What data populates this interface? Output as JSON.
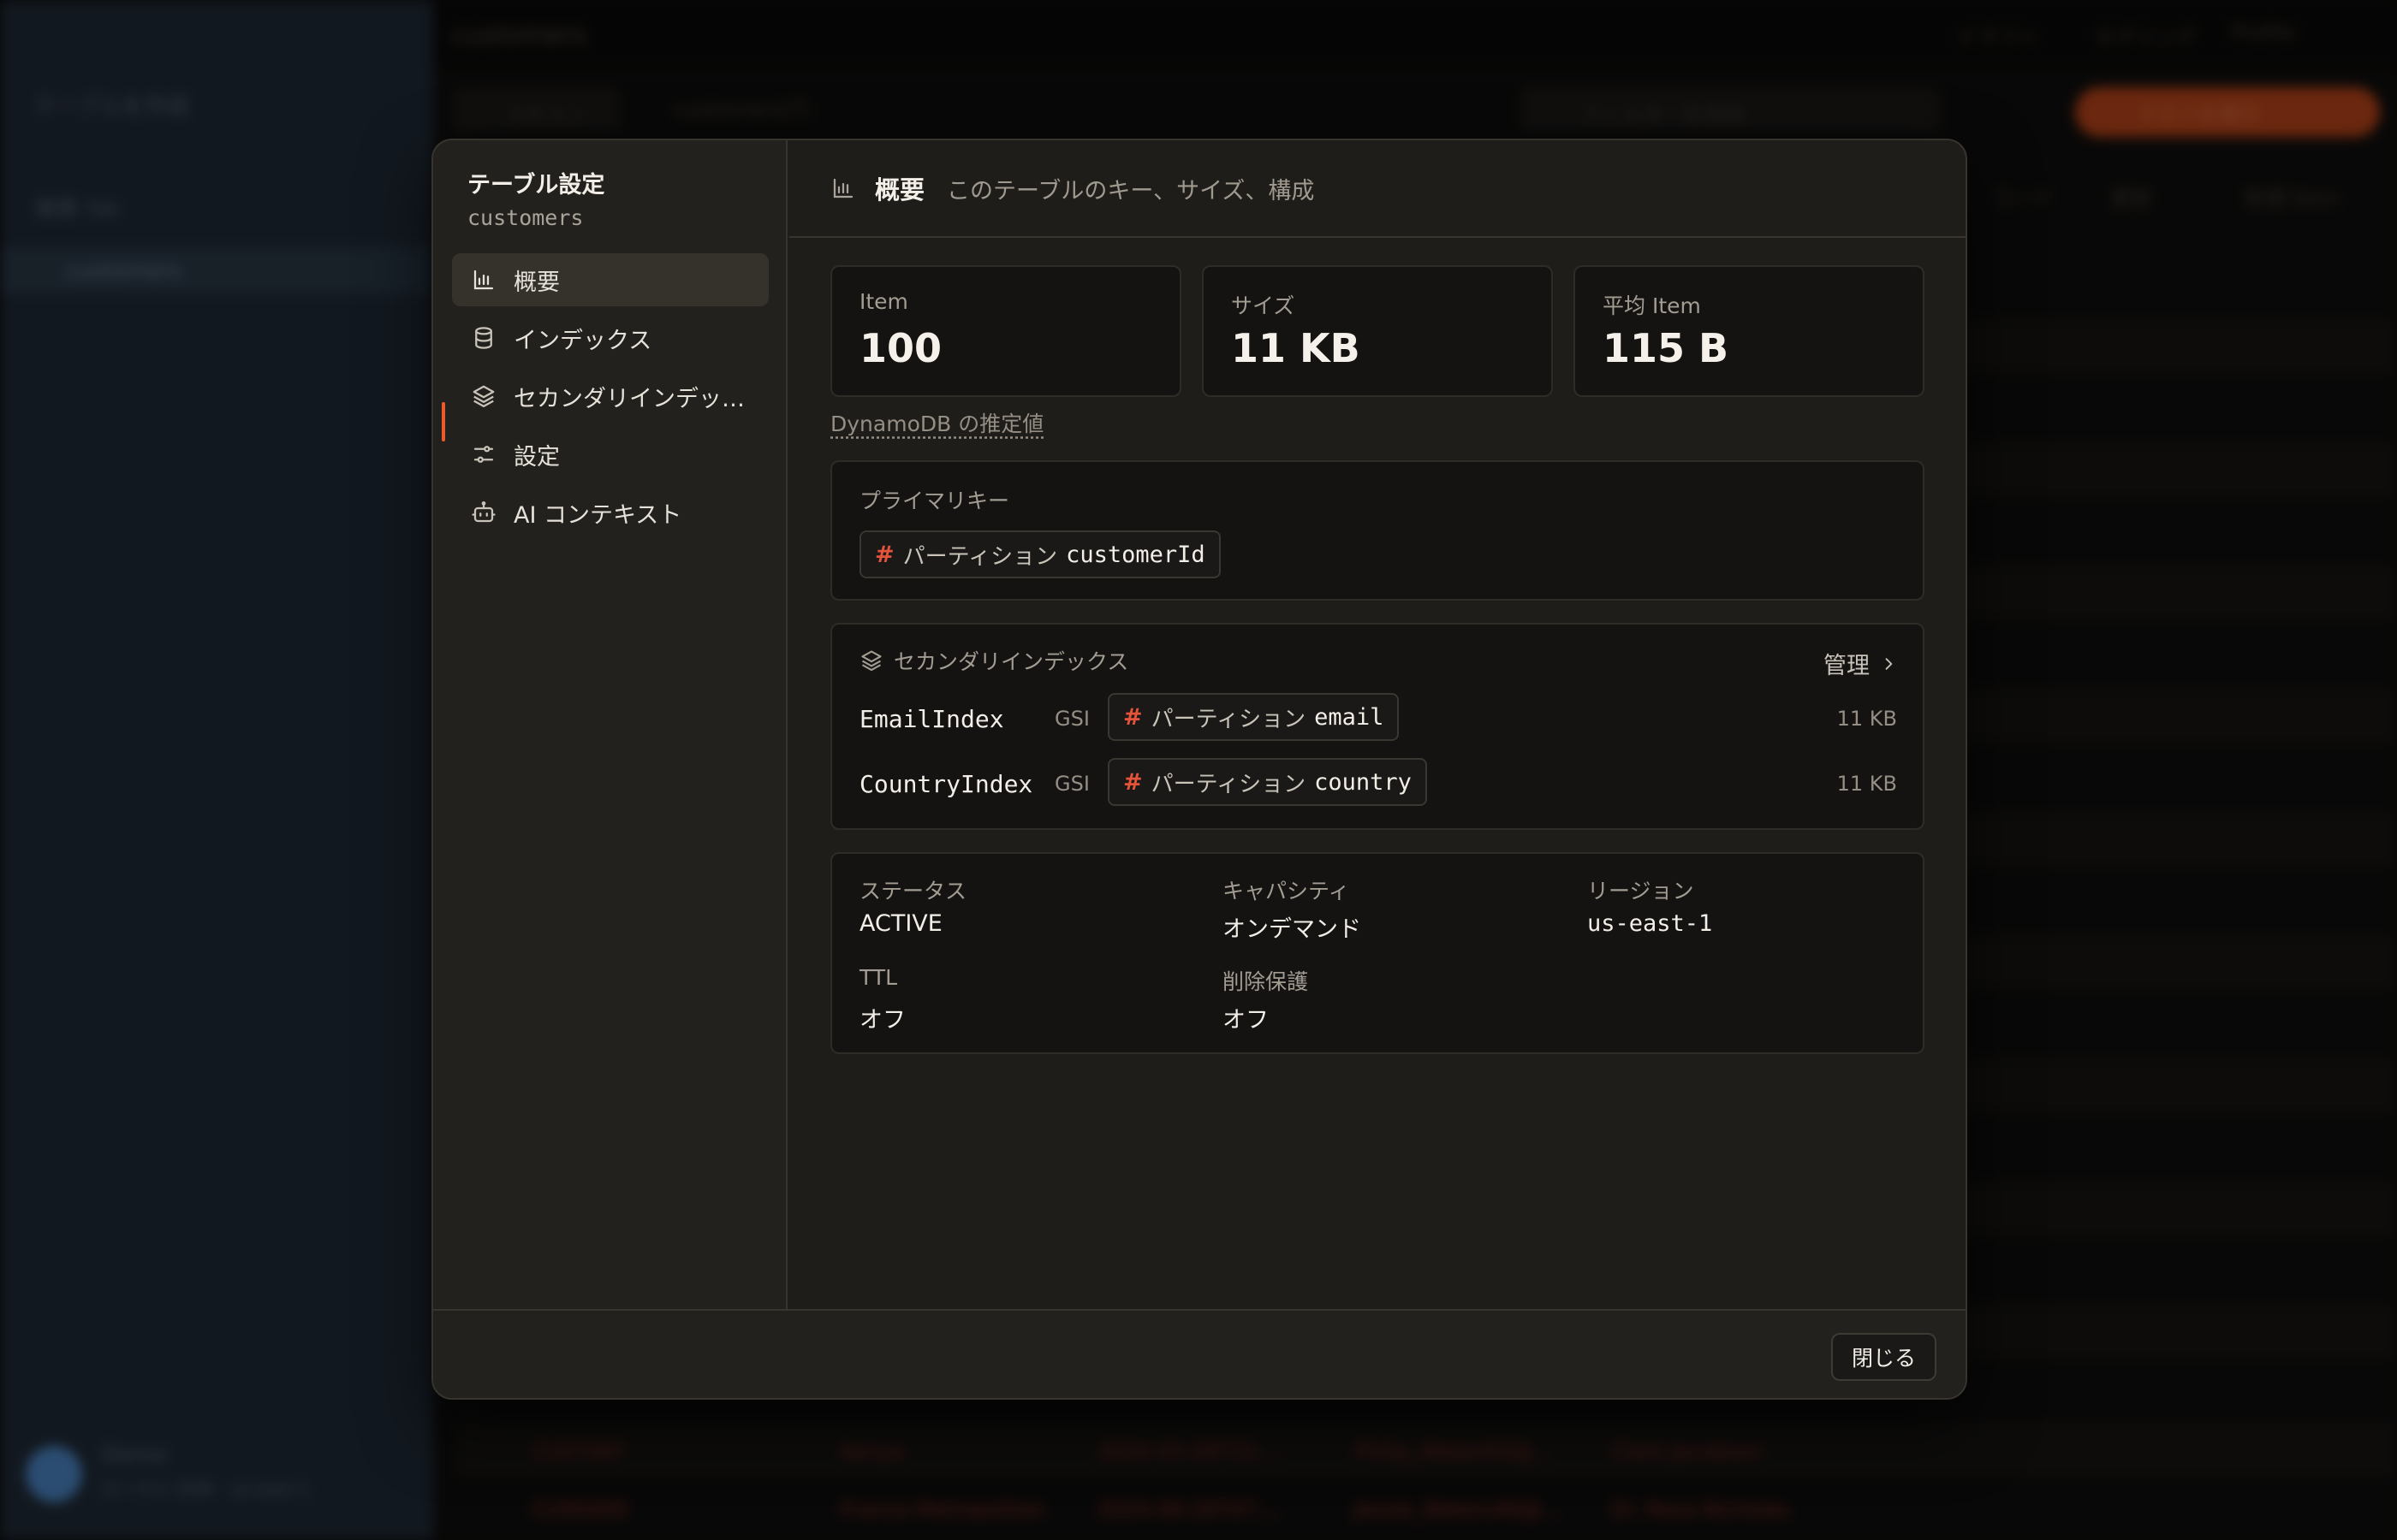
{
  "background": {
    "sidebar": {
      "create_label": "テーブルを作成",
      "search_label": "検索 %k",
      "active_item": "customers",
      "user_name": "Demo",
      "user_sub": "ローカル DDB · us-east-1"
    },
    "topbar": {
      "breadcrumb": "customers",
      "btn1": "ドラフト",
      "btn2": "モデリング",
      "btn3": "Profile"
    },
    "toolbar": {
      "scan": "スキャン",
      "table": "customers(T)",
      "filter_placeholder": "フィルターを追加",
      "run_label": "クエリを実行",
      "action1": "コード",
      "action2": "更新",
      "action3": "新規 Item"
    },
    "rows": [
      {
        "c1": "CUST087",
        "c2": "Kenya",
        "c3": "2024-03-28T15:...",
        "c4": "Philip_Weber83@...",
        "c5": "Clark Jacobson"
      },
      {
        "c1": "CU95009",
        "c2": "France Metropolitan",
        "c3": "2024-08-26T07:...",
        "c4": "Jessie_Waters46@...",
        "c5": "Dr. Rosa Nicholas"
      }
    ]
  },
  "modal": {
    "nav": {
      "title": "テーブル設定",
      "subtitle": "customers",
      "items": [
        {
          "label": "概要",
          "icon": "bar-chart-icon"
        },
        {
          "label": "インデックス",
          "icon": "database-icon"
        },
        {
          "label": "セカンダリインデックス",
          "icon": "layers-icon"
        },
        {
          "label": "設定",
          "icon": "sliders-icon"
        },
        {
          "label": "AI コンテキスト",
          "icon": "bot-icon"
        }
      ]
    },
    "header": {
      "title": "概要",
      "description": "このテーブルのキー、サイズ、構成"
    },
    "stats": [
      {
        "label": "Item",
        "value": "100"
      },
      {
        "label": "サイズ",
        "value": "11 KB"
      },
      {
        "label": "平均 Item",
        "value": "115 B"
      }
    ],
    "estimate_note": "DynamoDB の推定値",
    "primary_key": {
      "label": "プライマリキー",
      "type": "パーティション",
      "name": "customerId"
    },
    "secondary_indexes": {
      "label": "セカンダリインデックス",
      "manage_label": "管理",
      "items": [
        {
          "name": "EmailIndex",
          "kind": "GSI",
          "key_type": "パーティション",
          "key_name": "email",
          "size": "11 KB"
        },
        {
          "name": "CountryIndex",
          "kind": "GSI",
          "key_type": "パーティション",
          "key_name": "country",
          "size": "11 KB"
        }
      ]
    },
    "meta": {
      "status_label": "ステータス",
      "status_value": "ACTIVE",
      "capacity_label": "キャパシティ",
      "capacity_value": "オンデマンド",
      "region_label": "リージョン",
      "region_value": "us-east-1",
      "ttl_label": "TTL",
      "ttl_value": "オフ",
      "deletion_label": "削除保護",
      "deletion_value": "オフ"
    },
    "footer": {
      "close_label": "閉じる"
    }
  },
  "colors": {
    "accent": "#ef5a2a",
    "key_hash": "#e5533a",
    "panel": "#1f1d1a",
    "card": "#141312"
  }
}
